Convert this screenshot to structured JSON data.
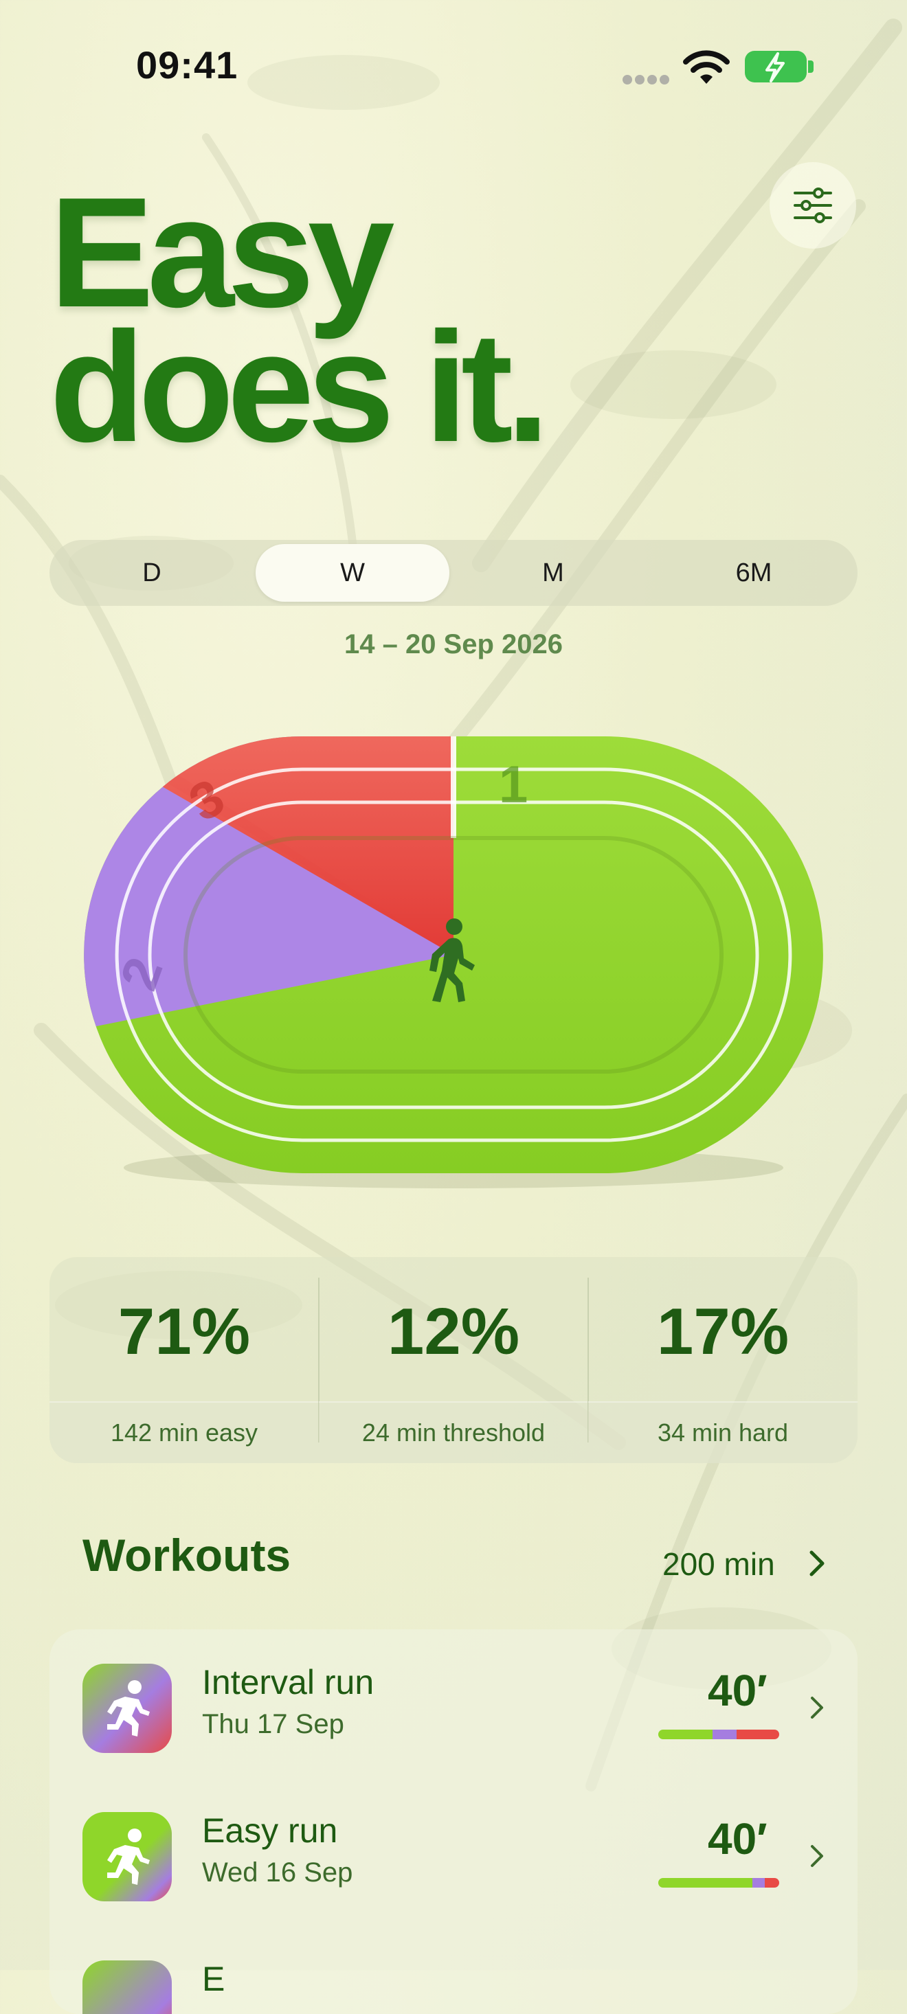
{
  "status_bar": {
    "time": "09:41"
  },
  "header": {
    "title_line1": "Easy",
    "title_line2": "does it."
  },
  "segments": [
    {
      "label": "D",
      "active": false
    },
    {
      "label": "W",
      "active": true
    },
    {
      "label": "M",
      "active": false
    },
    {
      "label": "6M",
      "active": false
    }
  ],
  "date_range": "14 – 20 Sep 2026",
  "track": {
    "zone_labels": [
      "1",
      "2",
      "3"
    ],
    "zone_shares": {
      "easy": 71,
      "threshold": 12,
      "hard": 17
    },
    "colors": {
      "easy": "#8fd62a",
      "threshold": "#a57de0",
      "hard": "#e84a45"
    },
    "center_icon": "walking-figure-icon"
  },
  "stats": [
    {
      "value": "71%",
      "label": "142 min easy"
    },
    {
      "value": "12%",
      "label": "24 min threshold"
    },
    {
      "value": "17%",
      "label": "34 min hard"
    }
  ],
  "workouts": {
    "title": "Workouts",
    "total": "200 min",
    "items": [
      {
        "name": "Interval run",
        "date": "Thu 17 Sep",
        "duration": "40′",
        "icon": "running-figure-icon",
        "zones": [
          0.45,
          0.2,
          0.35
        ]
      },
      {
        "name": "Easy run",
        "date": "Wed 16 Sep",
        "duration": "40′",
        "icon": "running-figure-icon",
        "zones": [
          0.78,
          0.1,
          0.12
        ]
      },
      {
        "name": "E",
        "icon": "running-figure-icon"
      }
    ]
  }
}
